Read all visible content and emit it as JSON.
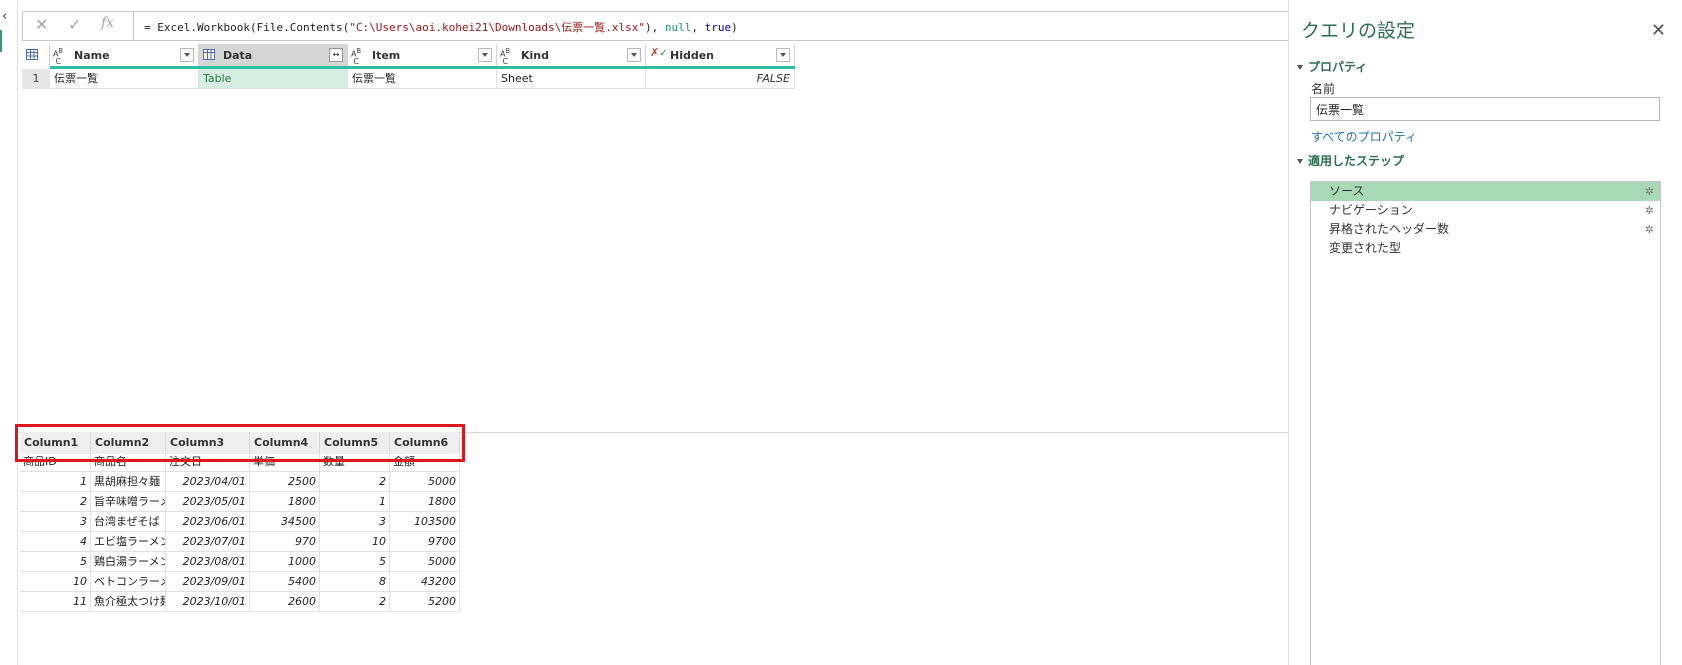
{
  "formula_bar": {
    "cancel_icon": "✕",
    "confirm_icon": "✓",
    "fx_icon": "fx",
    "formula_prefix": "= Excel.Workbook(File.Contents(",
    "formula_path": "\"C:\\Users\\aoi.kohei21\\Downloads\\伝票一覧.xlsx\"",
    "formula_middle": "), ",
    "formula_null": "null",
    "formula_comma": ", ",
    "formula_true": "true",
    "formula_suffix": ")"
  },
  "grid": {
    "columns": [
      {
        "label": "Name",
        "type": "ABC"
      },
      {
        "label": "Data",
        "type": "table"
      },
      {
        "label": "Item",
        "type": "ABC"
      },
      {
        "label": "Kind",
        "type": "ABC"
      },
      {
        "label": "Hidden",
        "type": "bool"
      }
    ],
    "rows": [
      {
        "num": "1",
        "name": "伝票一覧",
        "data": "Table",
        "item": "伝票一覧",
        "kind": "Sheet",
        "hidden": "FALSE"
      }
    ]
  },
  "preview": {
    "columns": [
      "Column1",
      "Column2",
      "Column3",
      "Column4",
      "Column5",
      "Column6"
    ],
    "first_row": [
      "商品ID",
      "商品名",
      "注文日",
      "単価",
      "数量",
      "金額"
    ],
    "rows": [
      [
        "1",
        "黒胡麻担々麺",
        "2023/04/01",
        "2500",
        "2",
        "5000"
      ],
      [
        "2",
        "旨辛味噌ラーメン",
        "2023/05/01",
        "1800",
        "1",
        "1800"
      ],
      [
        "3",
        "台湾まぜそば",
        "2023/06/01",
        "34500",
        "3",
        "103500"
      ],
      [
        "4",
        "エビ塩ラーメン",
        "2023/07/01",
        "970",
        "10",
        "9700"
      ],
      [
        "5",
        "鶏白湯ラーメン",
        "2023/08/01",
        "1000",
        "5",
        "5000"
      ],
      [
        "10",
        "ベトコンラーメン",
        "2023/09/01",
        "5400",
        "8",
        "43200"
      ],
      [
        "11",
        "魚介極太つけ麺",
        "2023/10/01",
        "2600",
        "2",
        "5200"
      ]
    ]
  },
  "query_settings": {
    "title": "クエリの設定",
    "properties_header": "プロパティ",
    "name_label": "名前",
    "name_value": "伝票一覧",
    "all_properties_link": "すべてのプロパティ",
    "steps_header": "適用したステップ",
    "steps": [
      {
        "label": "ソース",
        "active": true,
        "gear": true
      },
      {
        "label": "ナビゲーション",
        "active": false,
        "gear": true
      },
      {
        "label": "昇格されたヘッダー数",
        "active": false,
        "gear": true
      },
      {
        "label": "変更された型",
        "active": false,
        "gear": false
      }
    ]
  },
  "colors": {
    "accent_green": "#2a6f4f",
    "query_bar": "#2dbfa6",
    "highlight": "#e0161e"
  }
}
